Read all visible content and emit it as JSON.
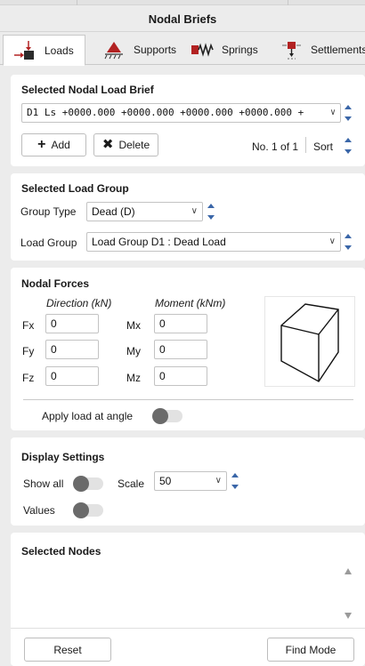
{
  "window": {
    "title": "Nodal Briefs"
  },
  "tabs": [
    {
      "label": "Loads",
      "icon": "load-arrow-icon",
      "active": true
    },
    {
      "label": "Supports",
      "icon": "support-triangle-icon",
      "active": false
    },
    {
      "label": "Springs",
      "icon": "spring-icon",
      "active": false
    },
    {
      "label": "Settlements",
      "icon": "settlement-icon",
      "active": false
    }
  ],
  "nodal_load_brief": {
    "title": "Selected Nodal Load Brief",
    "value": "D1 Ls +0000.000 +0000.000 +0000.000 +0000.000 +",
    "add_label": "Add",
    "delete_label": "Delete",
    "page_indicator": "No. 1 of 1",
    "sort_label": "Sort"
  },
  "load_group": {
    "title": "Selected Load Group",
    "group_type_label": "Group Type",
    "group_type_value": "Dead (D)",
    "load_group_label": "Load Group",
    "load_group_value": "Load Group D1 : Dead Load"
  },
  "nodal_forces": {
    "title": "Nodal Forces",
    "direction_header": "Direction (kN)",
    "moment_header": "Moment (kNm)",
    "fx_label": "Fx",
    "fx_value": "0",
    "fy_label": "Fy",
    "fy_value": "0",
    "fz_label": "Fz",
    "fz_value": "0",
    "mx_label": "Mx",
    "mx_value": "0",
    "my_label": "My",
    "my_value": "0",
    "mz_label": "Mz",
    "mz_value": "0",
    "angle_label": "Apply load at angle",
    "angle_enabled": false
  },
  "display_settings": {
    "title": "Display Settings",
    "show_all_label": "Show all",
    "show_all_enabled": false,
    "scale_label": "Scale",
    "scale_value": "50",
    "values_label": "Values",
    "values_enabled": false
  },
  "selected_nodes": {
    "title": "Selected Nodes",
    "items": []
  },
  "footer": {
    "reset_label": "Reset",
    "find_mode_label": "Find Mode"
  },
  "colors": {
    "accent_red": "#b22222",
    "spinner_blue": "#3a66a8"
  }
}
